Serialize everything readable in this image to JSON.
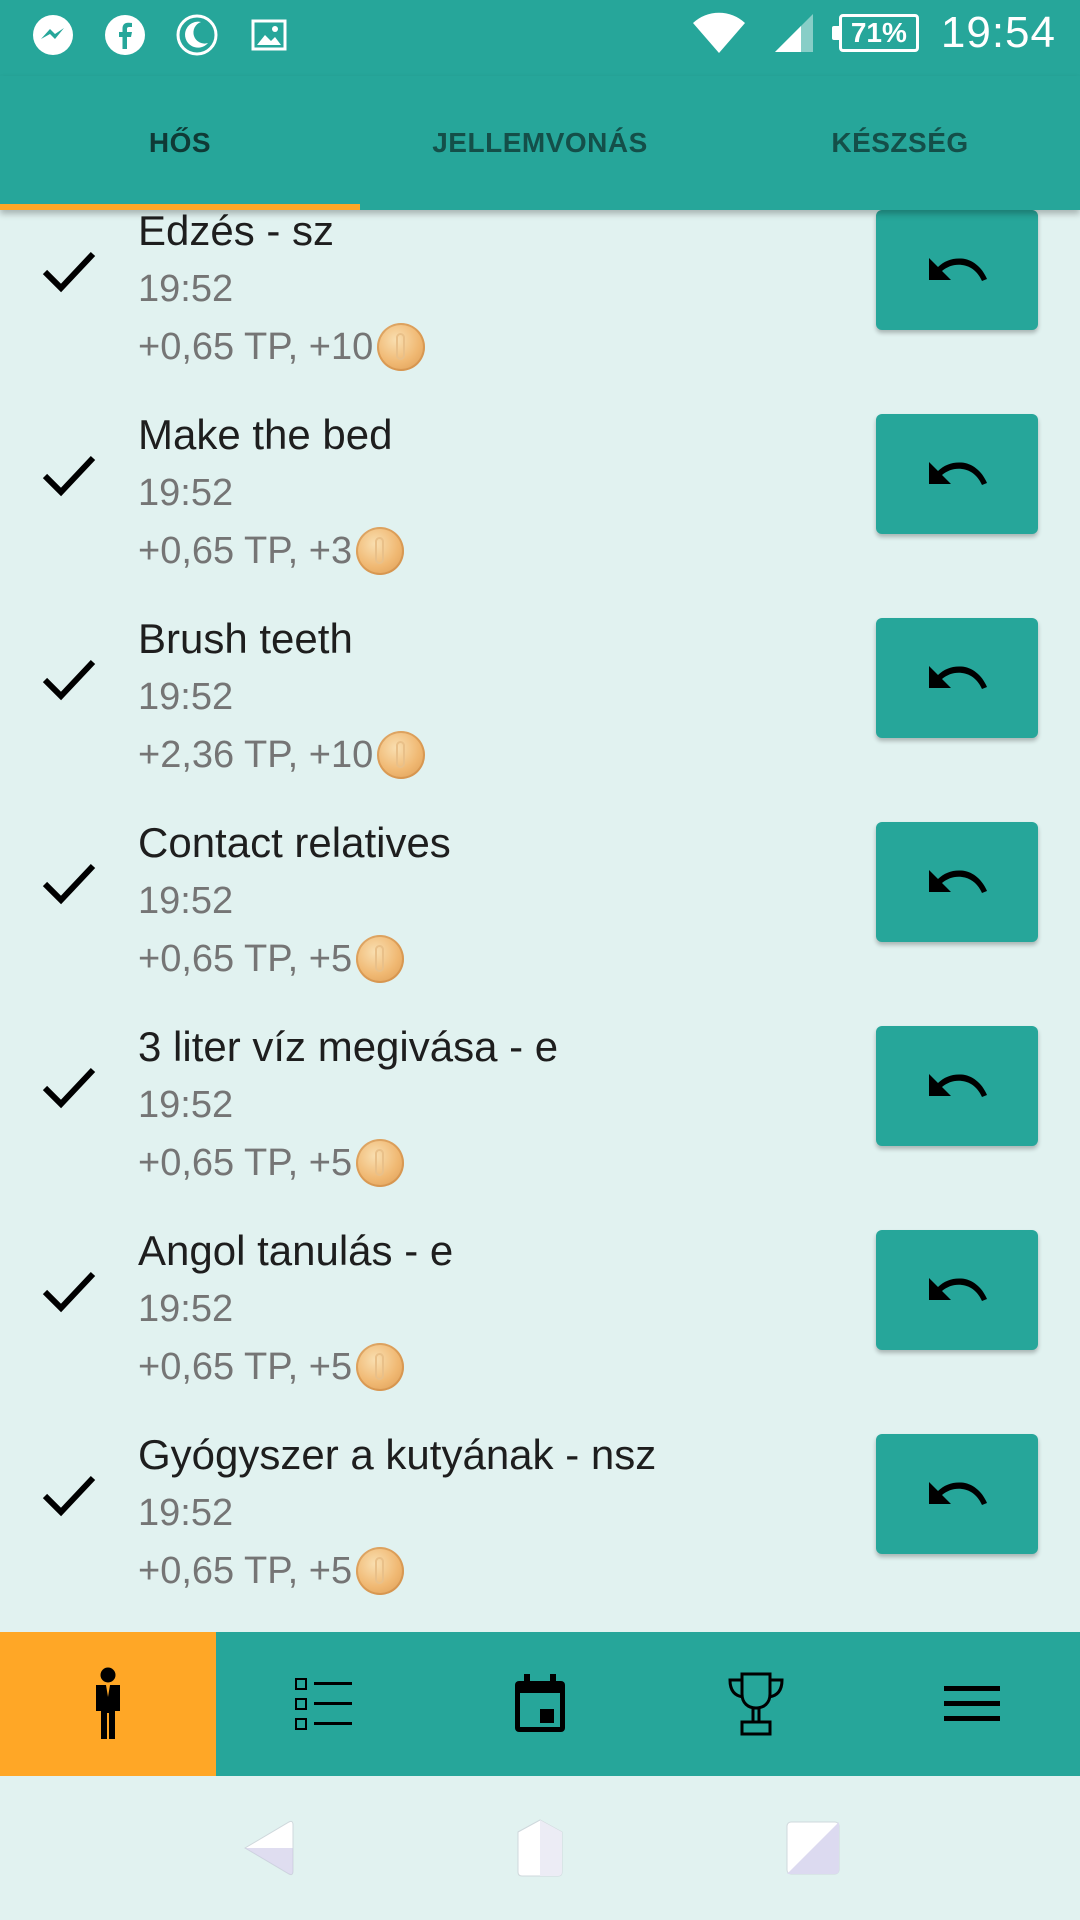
{
  "status_bar": {
    "icons_left": [
      "messenger-icon",
      "facebook-icon",
      "night-mode-icon",
      "gallery-icon"
    ],
    "icons_right": [
      "wifi-icon",
      "signal-icon"
    ],
    "battery": "71%",
    "time": "19:54"
  },
  "tabs": [
    {
      "label": "HŐS",
      "active": true
    },
    {
      "label": "JELLEMVONÁS",
      "active": false
    },
    {
      "label": "KÉSZSÉG",
      "active": false
    }
  ],
  "items": [
    {
      "title": "Edzés - sz",
      "time": "19:52",
      "reward": "+0,65 TP, +10"
    },
    {
      "title": "Make the bed",
      "time": "19:52",
      "reward": "+0,65 TP, +3"
    },
    {
      "title": "Brush teeth",
      "time": "19:52",
      "reward": "+2,36 TP, +10"
    },
    {
      "title": "Contact relatives",
      "time": "19:52",
      "reward": "+0,65 TP, +5"
    },
    {
      "title": "3 liter víz megivása - e",
      "time": "19:52",
      "reward": "+0,65 TP, +5"
    },
    {
      "title": "Angol tanulás - e",
      "time": "19:52",
      "reward": "+0,65 TP, +5"
    },
    {
      "title": "Gyógyszer a kutyának - nsz",
      "time": "19:52",
      "reward": "+0,65 TP, +5"
    }
  ],
  "bottom_nav": [
    {
      "icon": "hero-person-icon",
      "active": true
    },
    {
      "icon": "checklist-icon",
      "active": false
    },
    {
      "icon": "calendar-icon",
      "active": false
    },
    {
      "icon": "trophy-icon",
      "active": false
    },
    {
      "icon": "menu-icon",
      "active": false
    }
  ],
  "colors": {
    "primary": "#26a69a",
    "accent": "#ffa726",
    "background": "#e1f2f0"
  }
}
